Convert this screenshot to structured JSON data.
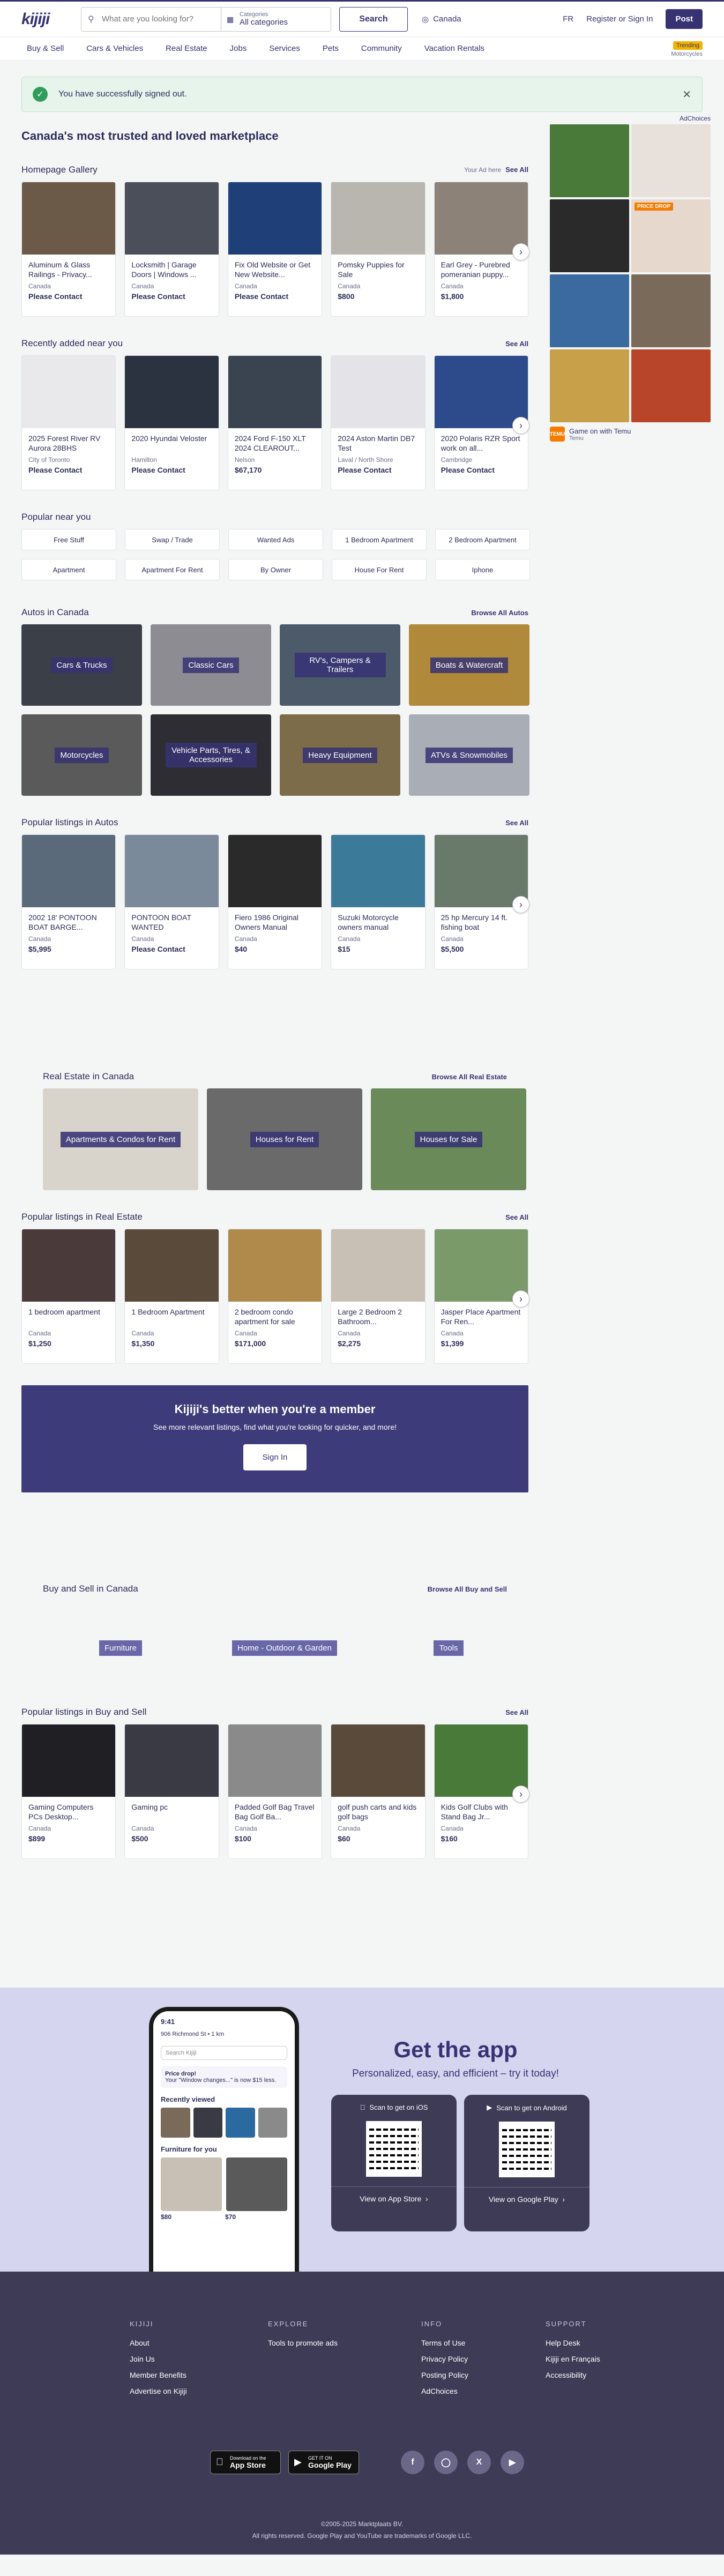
{
  "header": {
    "logo": "kijiji",
    "search_placeholder": "What are you looking for?",
    "category_label": "Categories",
    "category_value": "All categories",
    "search_button": "Search",
    "location": "Canada",
    "lang": "FR",
    "register": "Register or Sign In",
    "post": "Post"
  },
  "nav": {
    "items": [
      "Buy & Sell",
      "Cars & Vehicles",
      "Real Estate",
      "Jobs",
      "Services",
      "Pets",
      "Community",
      "Vacation Rentals"
    ],
    "trending_tag": "Trending",
    "trending_sub": "Motorcycles"
  },
  "alert": {
    "message": "You have successfully signed out."
  },
  "page_title": "Canada's most trusted and loved marketplace",
  "gallery": {
    "title": "Homepage Gallery",
    "your_ad": "Your Ad here",
    "see_all": "See All",
    "cards": [
      {
        "title": "Aluminum & Glass Railings - Privacy...",
        "loc": "Canada",
        "price": "Please Contact",
        "color": "#6b5a48"
      },
      {
        "title": "Locksmith | Garage Doors | Windows ...",
        "loc": "Canada",
        "price": "Please Contact",
        "color": "#4a4f5a"
      },
      {
        "title": "Fix Old Website or Get New Website...",
        "loc": "Canada",
        "price": "Please Contact",
        "color": "#1e3f78"
      },
      {
        "title": "Pomsky Puppies for Sale",
        "loc": "Canada",
        "price": "$800",
        "color": "#b9b6b0"
      },
      {
        "title": "Earl Grey - Purebred pomeranian puppy...",
        "loc": "Canada",
        "price": "$1,800",
        "color": "#8c8277"
      }
    ]
  },
  "recent": {
    "title": "Recently added near you",
    "see_all": "See All",
    "cards": [
      {
        "title": "2025 Forest River RV Aurora 28BHS",
        "loc": "City of Toronto",
        "price": "Please Contact",
        "color": "#e9e9ec"
      },
      {
        "title": "2020 Hyundai Veloster",
        "loc": "Hamilton",
        "price": "Please Contact",
        "color": "#2c3340"
      },
      {
        "title": "2024 Ford F-150 XLT 2024 CLEAROUT...",
        "loc": "Nelson",
        "price": "$67,170",
        "color": "#3a4450"
      },
      {
        "title": "2024 Aston Martin DB7 Test",
        "loc": "Laval / North Shore",
        "price": "Please Contact",
        "color": "#e4e4e8"
      },
      {
        "title": "2020 Polaris RZR Sport work on all...",
        "loc": "Cambridge",
        "price": "Please Contact",
        "color": "#2d4a8a"
      }
    ]
  },
  "popular_near": {
    "title": "Popular near you",
    "items": [
      "Free Stuff",
      "Swap / Trade",
      "Wanted Ads",
      "1 Bedroom Apartment",
      "2 Bedroom Apartment",
      "Apartment",
      "Apartment For Rent",
      "By Owner",
      "House For Rent",
      "Iphone"
    ]
  },
  "autos": {
    "title": "Autos in Canada",
    "browse": "Browse All Autos",
    "tiles": [
      {
        "label": "Cars & Trucks",
        "color": "#3a3f48"
      },
      {
        "label": "Classic Cars",
        "color": "#8c8c92"
      },
      {
        "label": "RV's, Campers & Trailers",
        "color": "#4d5a6a"
      },
      {
        "label": "Boats & Watercraft",
        "color": "#b08a3a"
      },
      {
        "label": "Motorcycles",
        "color": "#5a5a5a"
      },
      {
        "label": "Vehicle Parts, Tires, & Accessories",
        "color": "#2d2d33"
      },
      {
        "label": "Heavy Equipment",
        "color": "#7c6c4a"
      },
      {
        "label": "ATVs & Snowmobiles",
        "color": "#a8adb6"
      }
    ]
  },
  "pop_autos": {
    "title": "Popular listings in Autos",
    "see_all": "See All",
    "cards": [
      {
        "title": "2002 18' PONTOON BOAT BARGE...",
        "loc": "Canada",
        "price": "$5,995",
        "color": "#5a6a7a"
      },
      {
        "title": "PONTOON BOAT WANTED",
        "loc": "Canada",
        "price": "Please Contact",
        "color": "#7a8a9a"
      },
      {
        "title": "Fiero 1986 Original Owners Manual",
        "loc": "Canada",
        "price": "$40",
        "color": "#2a2a2a"
      },
      {
        "title": "Suzuki Motorcycle owners manual",
        "loc": "Canada",
        "price": "$15",
        "color": "#3c7a9a"
      },
      {
        "title": "25 hp Mercury 14 ft. fishing boat",
        "loc": "Canada",
        "price": "$5,500",
        "color": "#6a7a6a"
      }
    ]
  },
  "realestate": {
    "title": "Real Estate in Canada",
    "browse": "Browse All Real Estate",
    "tiles": [
      {
        "label": "Apartments & Condos for Rent",
        "color": "#d8d4cc"
      },
      {
        "label": "Houses for Rent",
        "color": "#6a6a6a"
      },
      {
        "label": "Houses for Sale",
        "color": "#6a8a5a"
      }
    ]
  },
  "pop_re": {
    "title": "Popular listings in Real Estate",
    "see_all": "See All",
    "cards": [
      {
        "title": "1 bedroom apartment",
        "loc": "Canada",
        "price": "$1,250",
        "color": "#4a3a3a"
      },
      {
        "title": "1 Bedroom Apartment",
        "loc": "Canada",
        "price": "$1,350",
        "color": "#5a4a3a"
      },
      {
        "title": "2 bedroom condo apartment for sale",
        "loc": "Canada",
        "price": "$171,000",
        "color": "#b08a4a"
      },
      {
        "title": "Large 2 Bedroom 2 Bathroom...",
        "loc": "Canada",
        "price": "$2,275",
        "color": "#c8c0b4"
      },
      {
        "title": "Jasper Place Apartment For Ren...",
        "loc": "Canada",
        "price": "$1,399",
        "color": "#7a9a6a"
      }
    ]
  },
  "member": {
    "title": "Kijiji's better when you're a member",
    "text": "See more relevant listings, find what you're looking for quicker, and more!",
    "button": "Sign In"
  },
  "buysell": {
    "title": "Buy and Sell in Canada",
    "browse": "Browse All Buy and Sell",
    "tiles": [
      "Furniture",
      "Home - Outdoor & Garden",
      "Tools"
    ]
  },
  "pop_bs": {
    "title": "Popular listings in Buy and Sell",
    "see_all": "See All",
    "cards": [
      {
        "title": "Gaming Computers PCs Desktop...",
        "loc": "Canada",
        "price": "$899",
        "color": "#202024"
      },
      {
        "title": "Gaming pc",
        "loc": "Canada",
        "price": "$500",
        "color": "#3a3a44"
      },
      {
        "title": "Padded Golf Bag Travel Bag Golf Ba...",
        "loc": "Canada",
        "price": "$100",
        "color": "#8a8a8a"
      },
      {
        "title": "golf push carts and kids golf bags",
        "loc": "Canada",
        "price": "$60",
        "color": "#5a4a3a"
      },
      {
        "title": "Kids Golf Clubs with Stand Bag Jr...",
        "loc": "Canada",
        "price": "$160",
        "color": "#4a7a3a"
      }
    ]
  },
  "ad": {
    "adchoices": "AdChoices",
    "colors": [
      "#4a7a3a",
      "#e8e0da",
      "#2a2a2a",
      "#e6d8cc",
      "#3a6aa0",
      "#7a6a5a",
      "#c8a04a",
      "#b8442a"
    ],
    "label": "Game on with Temu",
    "brand": "Temu",
    "logo": "TEMU",
    "price_drop": "PRICE DROP"
  },
  "app": {
    "title": "Get the app",
    "subtitle": "Personalized, easy, and efficient – try it today!",
    "ios_scan": "Scan to get on iOS",
    "android_scan": "Scan to get on Android",
    "ios_view": "View on App Store",
    "android_view": "View on Google Play",
    "phone": {
      "time": "9:41",
      "address": "906 Richmond St • 1 km",
      "search": "Search Kijiji",
      "price_title": "Price drop!",
      "price_text": "Your \"Window changes...\" is now $15 less.",
      "recent": "Recently viewed",
      "furniture": "Furniture for you",
      "p1": "$80",
      "p2": "$70"
    }
  },
  "footer": {
    "cols": [
      {
        "head": "KIJIJI",
        "items": [
          "About",
          "Join Us",
          "Member Benefits",
          "Advertise on Kijiji"
        ]
      },
      {
        "head": "EXPLORE",
        "items": [
          "Tools to promote ads"
        ]
      },
      {
        "head": "INFO",
        "items": [
          "Terms of Use",
          "Privacy Policy",
          "Posting Policy",
          "AdChoices"
        ]
      },
      {
        "head": "SUPPORT",
        "items": [
          "Help Desk",
          "Kijiji en Français",
          "Accessibility"
        ]
      }
    ],
    "appstore_small": "Download on the",
    "appstore": "App Store",
    "gplay_small": "GET IT ON",
    "gplay": "Google Play",
    "copyright": "©2005-2025 Marktplaats BV.",
    "rights": "All rights reserved. Google Play and YouTube are trademarks of Google LLC."
  }
}
